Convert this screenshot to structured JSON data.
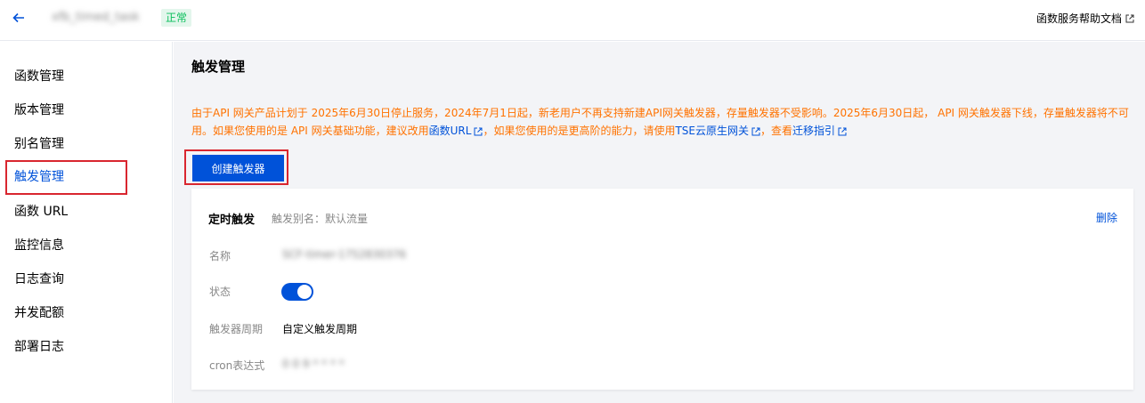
{
  "header": {
    "function_name": "xfb_timed_task",
    "status": "正常",
    "help_link": "函数服务帮助文档"
  },
  "sidebar": {
    "items": [
      {
        "label": "函数管理",
        "active": false
      },
      {
        "label": "版本管理",
        "active": false
      },
      {
        "label": "别名管理",
        "active": false
      },
      {
        "label": "触发管理",
        "active": true
      },
      {
        "label": "函数 URL",
        "active": false
      },
      {
        "label": "监控信息",
        "active": false
      },
      {
        "label": "日志查询",
        "active": false
      },
      {
        "label": "并发配额",
        "active": false
      },
      {
        "label": "部署日志",
        "active": false
      }
    ]
  },
  "main": {
    "title": "触发管理",
    "notice": {
      "text1": "由于API 网关产品计划于 2025年6月30日停止服务，2024年7月1日起，新老用户不再支持新建API网关触发器，存量触发器不受影响。2025年6月30日起， API 网关触发器下线，存量触发器将不可用。如果您使用的是 API 网关基础功能，建议改用",
      "link1": "函数URL",
      "text2": "，如果您使用的是更高阶的能力，请使用",
      "link2": "TSE云原生网关",
      "text3": "，查看",
      "link3": "迁移指引"
    },
    "create_button": "创建触发器",
    "trigger": {
      "type": "定时触发",
      "alias": "触发别名：默认流量",
      "delete": "删除",
      "name_label": "名称",
      "name_value": "SCF-timer-1752830376",
      "status_label": "状态",
      "status_on": true,
      "period_label": "触发器周期",
      "period_value": "自定义触发周期",
      "cron_label": "cron表达式",
      "cron_value": "0 0 9 * * * *"
    }
  },
  "colors": {
    "accent": "#0052d9",
    "warning": "#ff7200",
    "success": "#0abf5b",
    "highlight_border": "#d9262f"
  }
}
